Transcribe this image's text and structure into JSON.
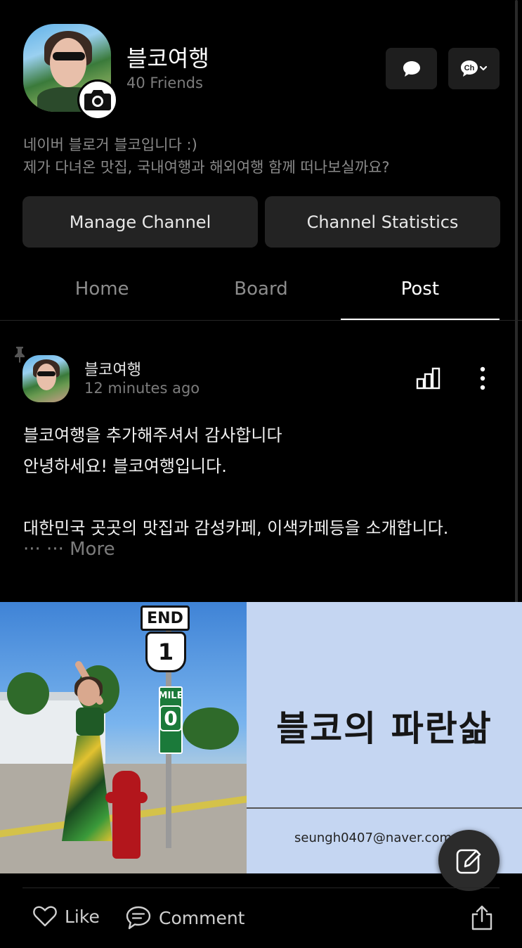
{
  "profile": {
    "name": "블코여행",
    "friends": "40 Friends",
    "description_line1": "네이버 블로거 블코입니다 :)",
    "description_line2": "제가 다녀온 맛집, 국내여행과 해외여행 함께 떠나보실까요?",
    "camera_icon": "camera-icon"
  },
  "header_buttons": {
    "chat_icon": "chat-bubble-icon",
    "channel_icon": "ch-dropdown-icon",
    "channel_label": "Ch"
  },
  "actions": {
    "manage": "Manage Channel",
    "statistics": "Channel Statistics"
  },
  "tabs": [
    {
      "label": "Home",
      "active": false
    },
    {
      "label": "Board",
      "active": false
    },
    {
      "label": "Post",
      "active": true
    }
  ],
  "post": {
    "author": "블코여행",
    "time": "12 minutes ago",
    "body": "블코여행을 추가해주셔서 감사합니다\n안녕하세요! 블코여행입니다.\n\n대한민국 곳곳의 맛집과 감성카페, 이색카페등을 소개합니다.",
    "more": "··· ··· More",
    "image": {
      "sign_end": "END",
      "sign_route": "1",
      "sign_mile": "MILE",
      "sign_mile_number": "0",
      "card_title": "블코의 파란삶",
      "card_email": "seungh0407@naver.com"
    }
  },
  "post_actions": {
    "like": "Like",
    "comment": "Comment"
  },
  "colors": {
    "background": "#000000",
    "button_bg": "#232323",
    "muted_text": "#7c7c7c",
    "card_bg": "#c5d6f2",
    "fab_bg": "#2b2b2b"
  }
}
